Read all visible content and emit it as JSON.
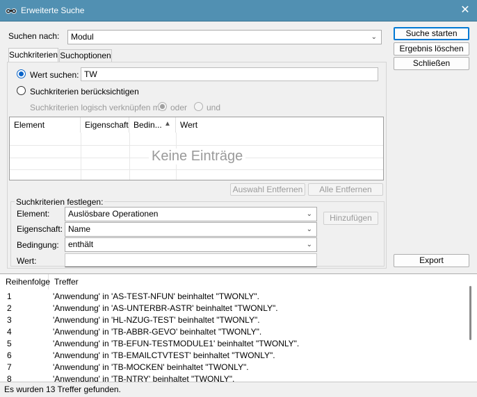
{
  "window": {
    "title": "Erweiterte Suche",
    "close_label": "✕"
  },
  "search_for": {
    "label": "Suchen nach:",
    "value": "Modul"
  },
  "buttons": {
    "start": "Suche starten",
    "clear": "Ergebnis löschen",
    "close": "Schließen",
    "export": "Export",
    "remove_selection": "Auswahl Entfernen",
    "remove_all": "Alle Entfernen",
    "add": "Hinzufügen"
  },
  "tabs": [
    {
      "label": "Suchkriterien",
      "active": true
    },
    {
      "label": "Suchoptionen",
      "active": false
    }
  ],
  "criteria": {
    "value_search_label": "Wert suchen:",
    "value_search_value": "TW",
    "consider_criteria_label": "Suchkriterien berücksichtigen",
    "logic_label": "Suchkriterien logisch verknüpfen mit:",
    "logic_or": "oder",
    "logic_and": "und"
  },
  "criteria_table": {
    "columns": [
      "Element",
      "Eigenschaft",
      "Bedin...",
      "Wert"
    ],
    "empty_text": "Keine Einträge"
  },
  "define": {
    "group_label": "Suchkriterien festlegen:",
    "element_label": "Element:",
    "element_value": "Auslösbare Operationen",
    "property_label": "Eigenschaft:",
    "property_value": "Name",
    "condition_label": "Bedingung:",
    "condition_value": "enthält",
    "value_label": "Wert:",
    "value_value": ""
  },
  "results": {
    "columns": [
      "Reihenfolge",
      "Treffer"
    ],
    "rows": [
      {
        "n": "1",
        "text": "'Anwendung' in 'AS-TEST-NFUN' beinhaltet \"TWONLY\"."
      },
      {
        "n": "2",
        "text": "'Anwendung' in 'AS-UNTERBR-ASTR' beinhaltet \"TWONLY\"."
      },
      {
        "n": "3",
        "text": "'Anwendung' in 'HL-NZUG-TEST' beinhaltet \"TWONLY\"."
      },
      {
        "n": "4",
        "text": "'Anwendung' in 'TB-ABBR-GEVO' beinhaltet \"TWONLY\"."
      },
      {
        "n": "5",
        "text": "'Anwendung' in 'TB-EFUN-TESTMODULE1' beinhaltet \"TWONLY\"."
      },
      {
        "n": "6",
        "text": "'Anwendung' in 'TB-EMAILCTVTEST' beinhaltet \"TWONLY\"."
      },
      {
        "n": "7",
        "text": "'Anwendung' in 'TB-MOCKEN' beinhaltet \"TWONLY\"."
      },
      {
        "n": "8",
        "text": "'Anwendung' in 'TB-NTRY' beinhaltet \"TWONLY\"."
      }
    ]
  },
  "status": "Es wurden 13 Treffer gefunden."
}
